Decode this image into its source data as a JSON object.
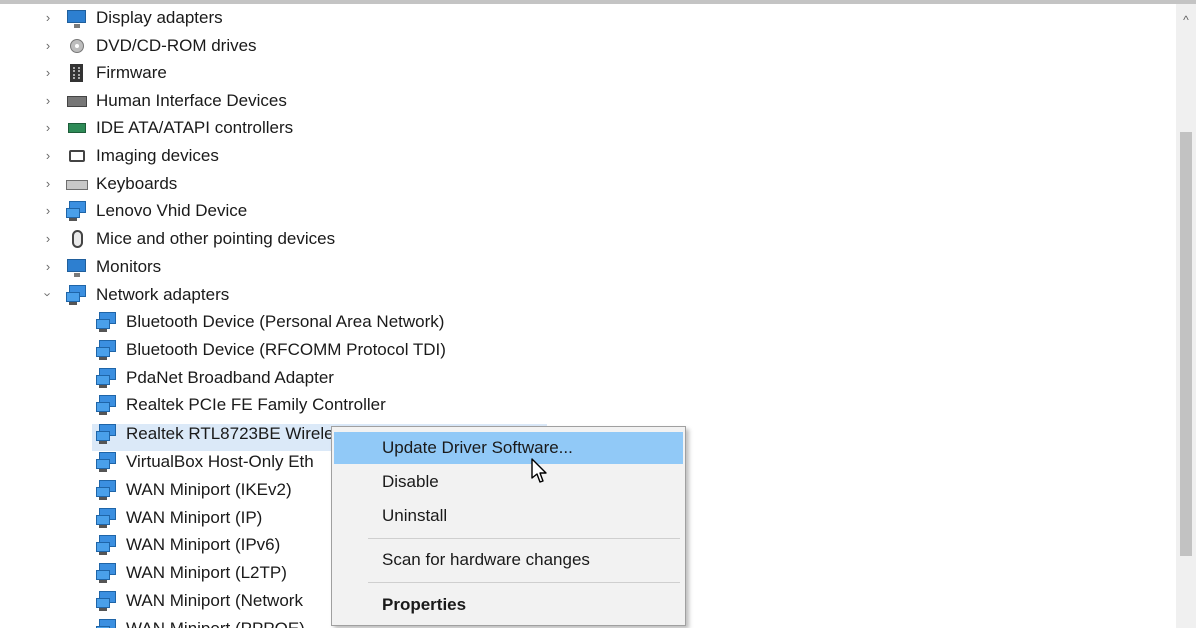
{
  "tree": {
    "categories": [
      {
        "label": "Display adapters",
        "icon": "display-adapter-icon",
        "expanded": false
      },
      {
        "label": "DVD/CD-ROM drives",
        "icon": "dvd-drive-icon",
        "expanded": false
      },
      {
        "label": "Firmware",
        "icon": "firmware-icon",
        "expanded": false
      },
      {
        "label": "Human Interface Devices",
        "icon": "hid-icon",
        "expanded": false
      },
      {
        "label": "IDE ATA/ATAPI controllers",
        "icon": "ide-controller-icon",
        "expanded": false
      },
      {
        "label": "Imaging devices",
        "icon": "imaging-device-icon",
        "expanded": false
      },
      {
        "label": "Keyboards",
        "icon": "keyboard-icon",
        "expanded": false
      },
      {
        "label": "Lenovo Vhid Device",
        "icon": "lenovo-device-icon",
        "expanded": false
      },
      {
        "label": "Mice and other pointing devices",
        "icon": "mouse-icon",
        "expanded": false
      },
      {
        "label": "Monitors",
        "icon": "monitor-icon",
        "expanded": false
      },
      {
        "label": "Network adapters",
        "icon": "network-adapter-icon",
        "expanded": true
      }
    ],
    "network_adapters": [
      "Bluetooth Device (Personal Area Network)",
      "Bluetooth Device (RFCOMM Protocol TDI)",
      "PdaNet Broadband Adapter",
      "Realtek PCIe FE Family Controller",
      "Realtek RTL8723BE Wirele",
      "VirtualBox Host-Only Eth",
      "WAN Miniport (IKEv2)",
      "WAN Miniport (IP)",
      "WAN Miniport (IPv6)",
      "WAN Miniport (L2TP)",
      "WAN Miniport (Network",
      "WAN Miniport (PPPOE)"
    ],
    "selected_index": 4
  },
  "context_menu": {
    "update_driver": "Update Driver Software...",
    "disable": "Disable",
    "uninstall": "Uninstall",
    "scan": "Scan for hardware changes",
    "properties": "Properties"
  },
  "scrollbar": {
    "up_arrow": "^"
  },
  "colors": {
    "highlight": "#91c9f7",
    "selection": "#dbe9f8",
    "icon_blue": "#3b8fe0"
  }
}
